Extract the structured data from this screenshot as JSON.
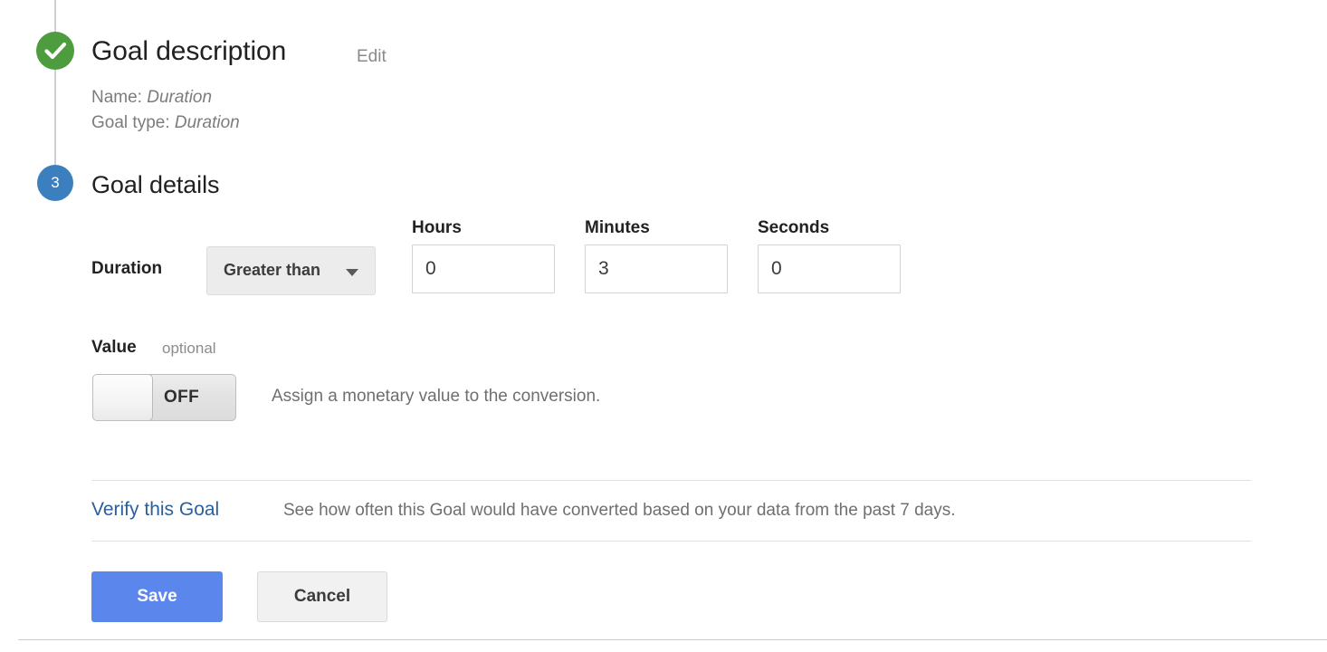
{
  "stepper": {
    "completed_step": {
      "icon": "check-icon",
      "status": "completed"
    },
    "current_step": {
      "number": "3"
    }
  },
  "goal_description": {
    "title": "Goal description",
    "edit_label": "Edit",
    "name_label": "Name:",
    "name_value": "Duration",
    "type_label": "Goal type:",
    "type_value": "Duration"
  },
  "goal_details": {
    "title": "Goal details",
    "duration": {
      "label": "Duration",
      "condition_selected": "Greater than",
      "fields": [
        {
          "label": "Hours",
          "value": "0"
        },
        {
          "label": "Minutes",
          "value": "3"
        },
        {
          "label": "Seconds",
          "value": "0"
        }
      ]
    },
    "value": {
      "label": "Value",
      "optional_label": "optional",
      "toggle_state": "OFF",
      "hint": "Assign a monetary value to the conversion."
    },
    "verify": {
      "link_label": "Verify this Goal",
      "description": "See how often this Goal would have converted based on your data from the past 7 days."
    },
    "actions": {
      "save_label": "Save",
      "cancel_label": "Cancel"
    }
  },
  "colors": {
    "step_done_green": "#4d9c3e",
    "step_current_blue": "#3c7fbe",
    "save_blue": "#5b87ec",
    "link_blue": "#2a5f9e"
  }
}
